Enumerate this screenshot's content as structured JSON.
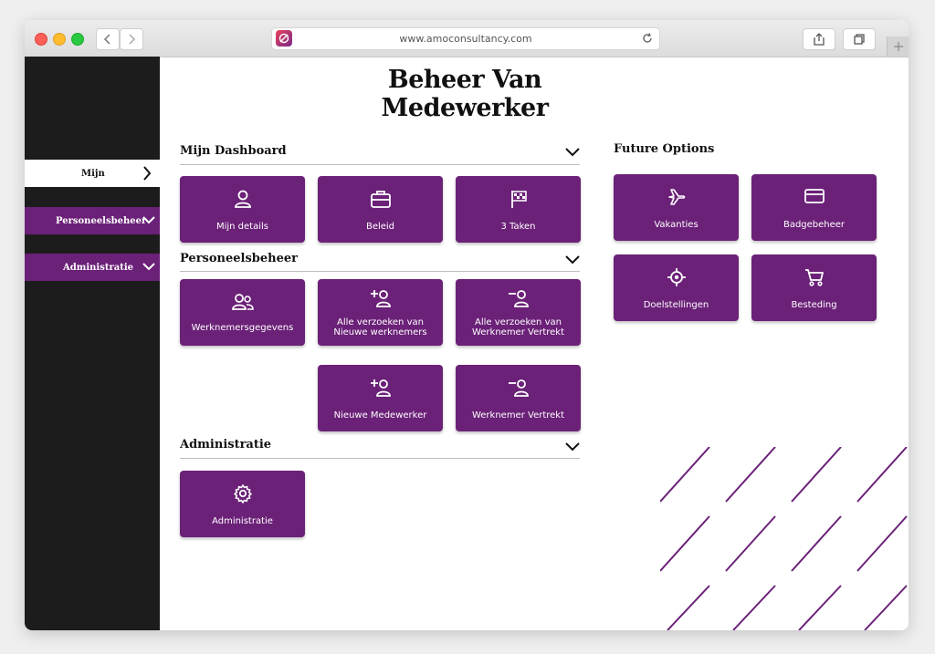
{
  "browser": {
    "url": "www.amoconsultancy.com"
  },
  "sidebar": {
    "items": [
      {
        "label": "Mijn"
      },
      {
        "label": "Personeelsbeheer"
      },
      {
        "label": "Administratie"
      }
    ]
  },
  "page": {
    "title": "Beheer Van Medewerker"
  },
  "sections": {
    "dashboard": {
      "title": "Mijn Dashboard",
      "cards": [
        {
          "label": "Mijn details",
          "icon": "user-icon"
        },
        {
          "label": "Beleid",
          "icon": "briefcase-icon"
        },
        {
          "label": "3 Taken",
          "icon": "flag-icon"
        }
      ]
    },
    "personeel": {
      "title": "Personeelsbeheer",
      "cards": [
        {
          "label": "Werknemersgegevens",
          "icon": "users-icon"
        },
        {
          "label_line1": "Alle verzoeken van",
          "label_line2": "Nieuwe werknemers",
          "icon": "user-plus-icon"
        },
        {
          "label_line1": "Alle verzoeken van",
          "label_line2": "Werknemer Vertrekt",
          "icon": "user-minus-icon"
        },
        {
          "label": "Nieuwe Medewerker",
          "icon": "user-plus-icon"
        },
        {
          "label": "Werknemer Vertrekt",
          "icon": "user-minus-icon"
        }
      ]
    },
    "administratie": {
      "title": "Administratie",
      "cards": [
        {
          "label": "Administratie",
          "icon": "gear-icon"
        }
      ]
    },
    "future": {
      "title": "Future Options",
      "cards": [
        {
          "label": "Vakanties",
          "icon": "plane-icon"
        },
        {
          "label": "Badgebeheer",
          "icon": "credit-card-icon"
        },
        {
          "label": "Doelstellingen",
          "icon": "target-icon"
        },
        {
          "label": "Besteding",
          "icon": "cart-icon"
        }
      ]
    }
  },
  "colors": {
    "accent": "#6b2178",
    "sidebar": "#1c1c1c"
  }
}
